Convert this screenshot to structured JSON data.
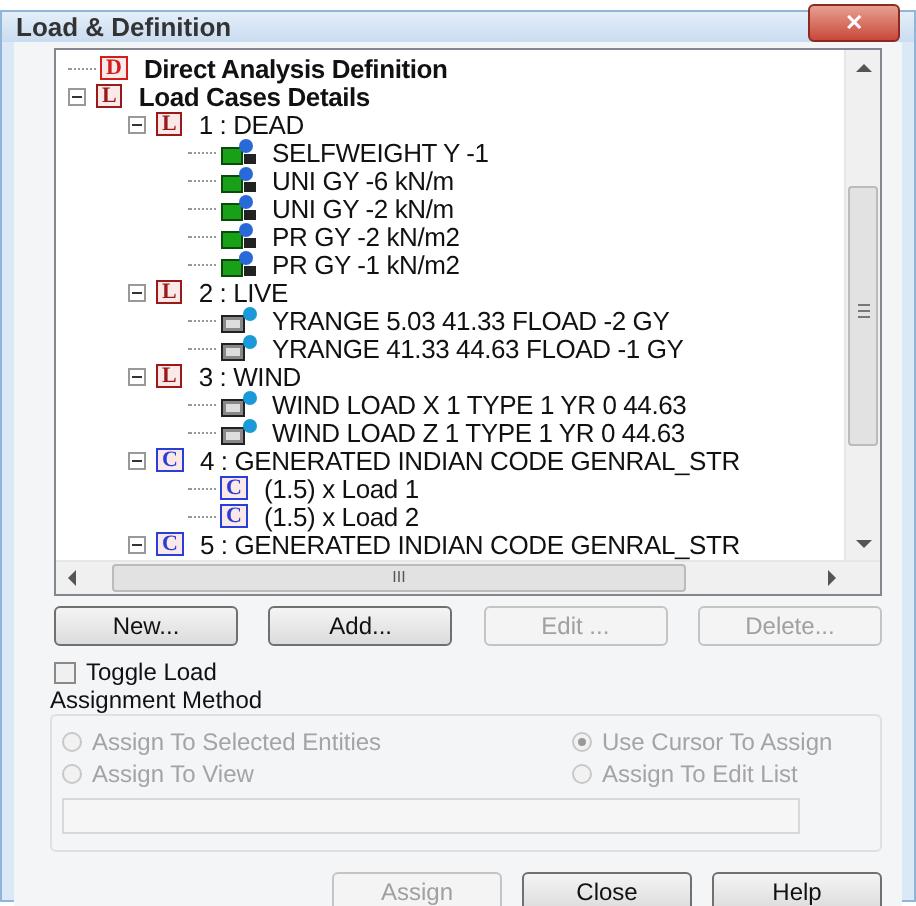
{
  "window": {
    "title": "Load & Definition",
    "close_glyph": "✕"
  },
  "tree": [
    {
      "label": "Direct Analysis Definition",
      "kind": "definition",
      "badge": "D"
    },
    {
      "label": "Load Cases Details",
      "kind": "load-case",
      "badge": "L",
      "expanded": true,
      "children": [
        {
          "label": "1 : DEAD",
          "kind": "load-case",
          "badge": "L",
          "expanded": true,
          "children": [
            {
              "label": "SELFWEIGHT Y -1",
              "kind": "member-load"
            },
            {
              "label": "UNI GY -6 kN/m",
              "kind": "member-load"
            },
            {
              "label": "UNI GY -2 kN/m",
              "kind": "member-load"
            },
            {
              "label": "PR GY -2  kN/m2",
              "kind": "member-load"
            },
            {
              "label": "PR GY -1  kN/m2",
              "kind": "member-load"
            }
          ]
        },
        {
          "label": "2 : LIVE",
          "kind": "load-case",
          "badge": "L",
          "expanded": true,
          "children": [
            {
              "label": "YRANGE 5.03 41.33 FLOAD -2 GY",
              "kind": "floor-load"
            },
            {
              "label": "YRANGE 41.33 44.63 FLOAD -1 GY",
              "kind": "floor-load"
            }
          ]
        },
        {
          "label": "3 : WIND",
          "kind": "load-case",
          "badge": "L",
          "expanded": true,
          "children": [
            {
              "label": "WIND LOAD X 1 TYPE 1 YR 0 44.63",
              "kind": "floor-load"
            },
            {
              "label": "WIND LOAD Z 1 TYPE 1 YR 0 44.63",
              "kind": "floor-load"
            }
          ]
        },
        {
          "label": "4 : GENERATED INDIAN CODE GENRAL_STR",
          "kind": "combination",
          "badge": "C",
          "expanded": true,
          "children": [
            {
              "label": "(1.5) x Load 1",
              "kind": "combination",
              "badge": "C"
            },
            {
              "label": "(1.5) x Load 2",
              "kind": "combination",
              "badge": "C"
            }
          ]
        },
        {
          "label": "5 : GENERATED INDIAN CODE GENRAL_STR",
          "kind": "combination",
          "badge": "C",
          "expanded": true
        }
      ]
    }
  ],
  "scroll_glyph": "III",
  "buttons": [
    {
      "label": "New...",
      "disabled": false
    },
    {
      "label": "Add...",
      "disabled": false
    },
    {
      "label": "Edit ...",
      "disabled": true
    },
    {
      "label": "Delete...",
      "disabled": true
    }
  ],
  "toggle_load": {
    "label": "Toggle Load",
    "checked": false
  },
  "assignment": {
    "title": "Assignment Method",
    "disabled": true,
    "options": [
      {
        "label": "Assign To Selected Entities",
        "selected": false
      },
      {
        "label": "Use Cursor To Assign",
        "selected": true
      },
      {
        "label": "Assign To View",
        "selected": false
      },
      {
        "label": "Assign To Edit List",
        "selected": false
      }
    ]
  },
  "footer_buttons": [
    {
      "label": "Assign",
      "disabled": true
    },
    {
      "label": "Close",
      "disabled": false
    },
    {
      "label": "Help",
      "disabled": false
    }
  ]
}
